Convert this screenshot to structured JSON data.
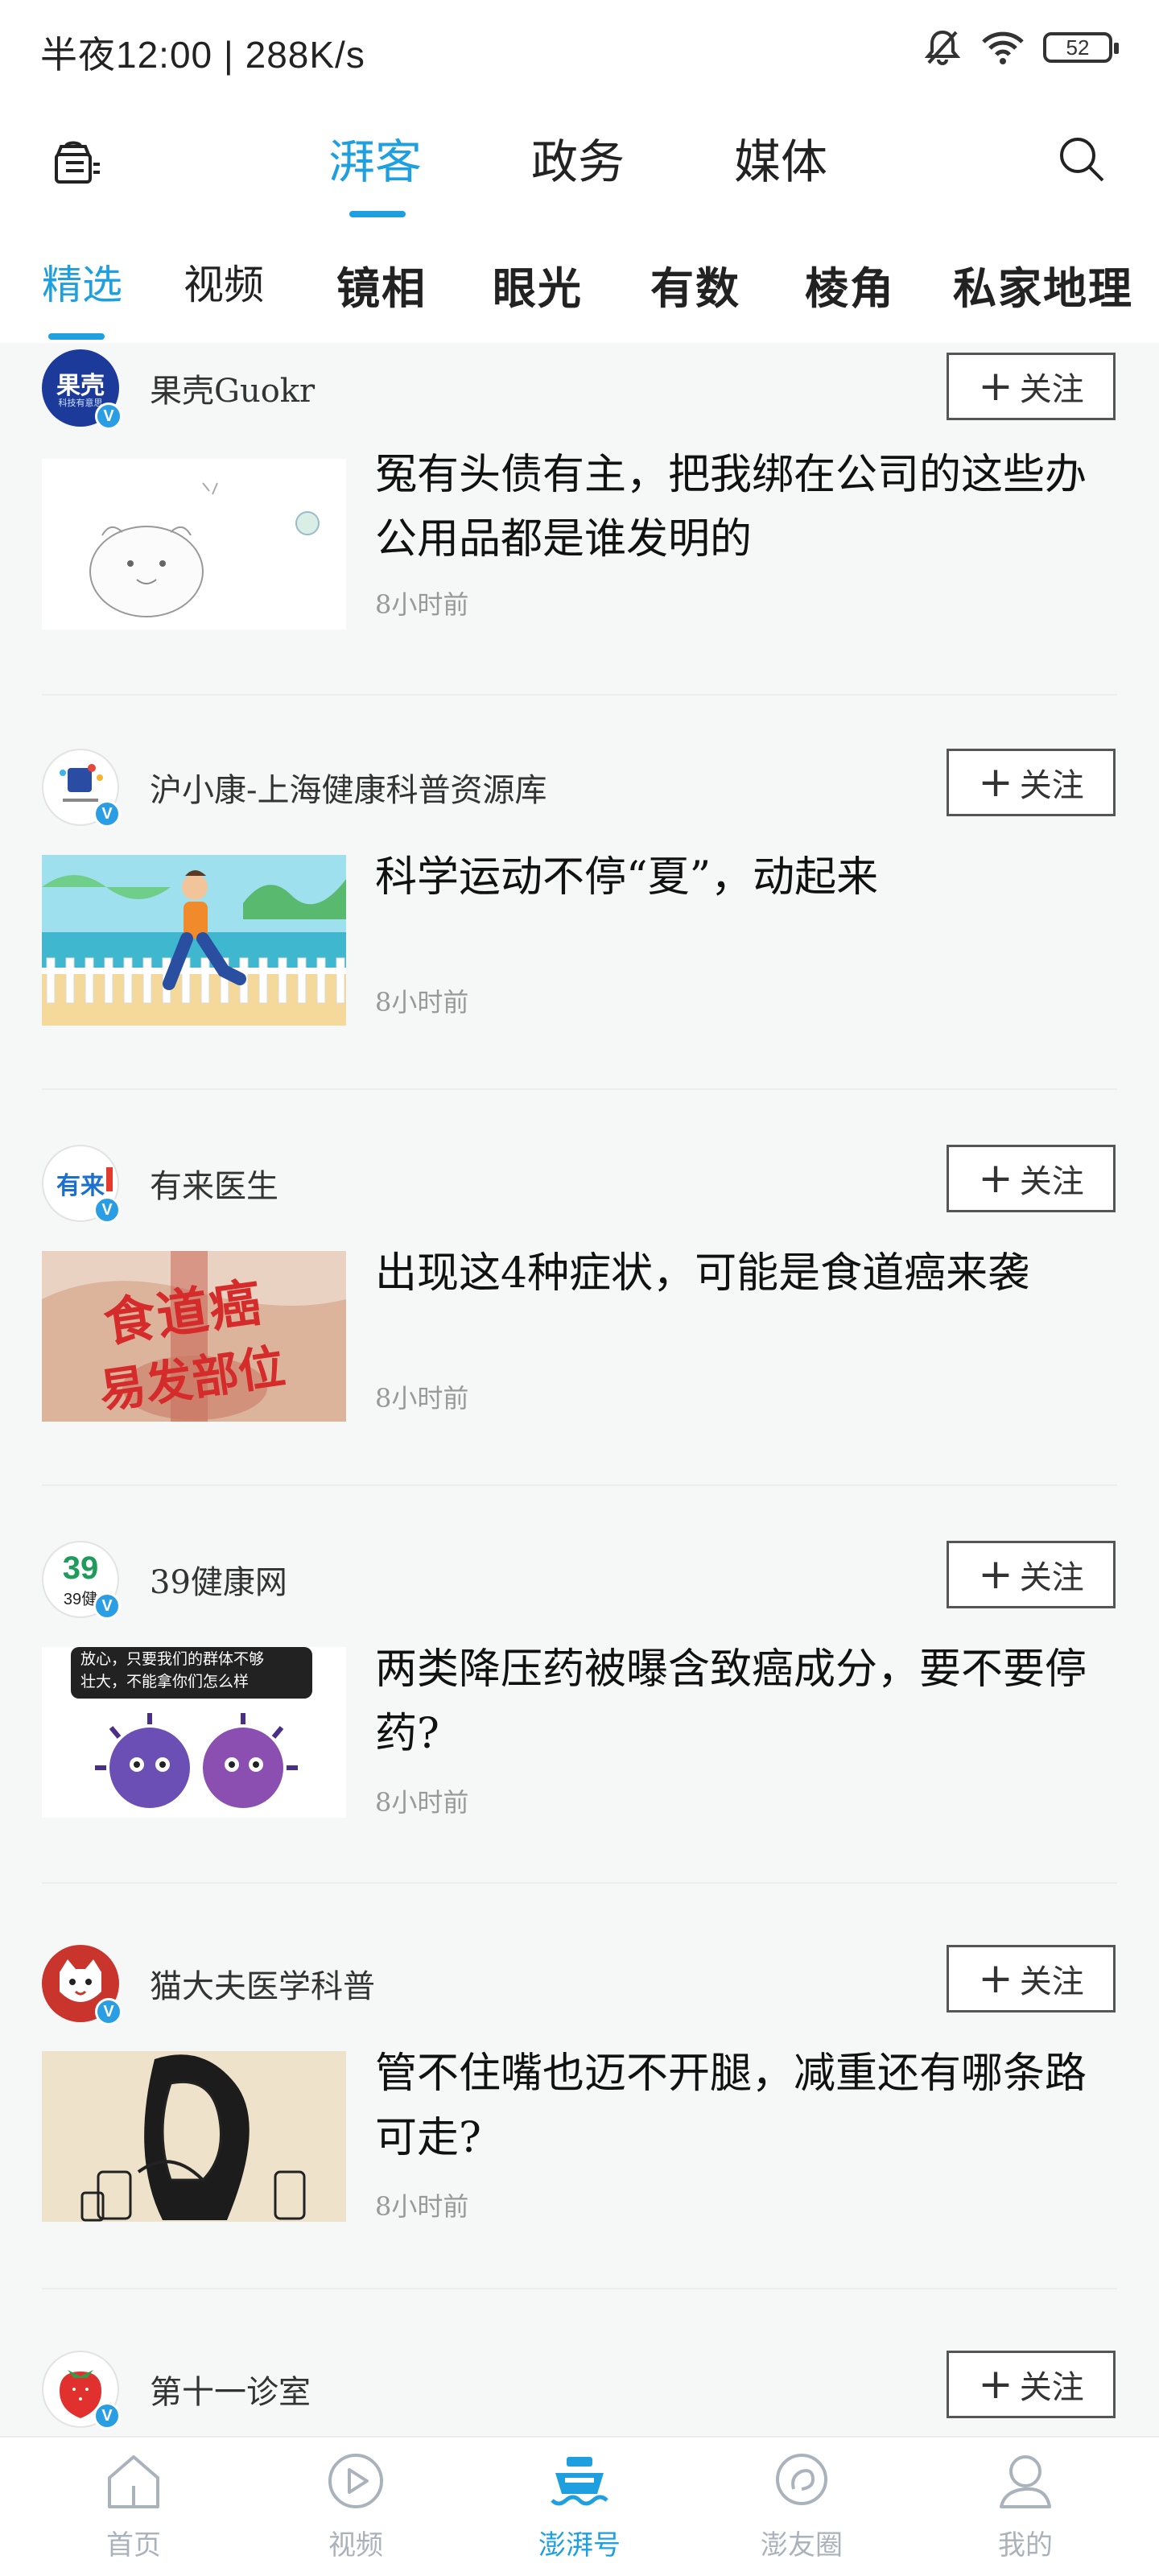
{
  "status_bar": {
    "time": "半夜12:00 | 288K/s",
    "battery": "52"
  },
  "header": {
    "tabs": [
      "湃客",
      "政务",
      "媒体"
    ],
    "active_tab": "湃客"
  },
  "subtabs": [
    "精选",
    "视频",
    "镜相",
    "眼光",
    "有数",
    "棱角",
    "私家地理"
  ],
  "follow_label": "关注",
  "feed": [
    {
      "author": "果壳Guokr",
      "title": "冤有头债有主，把我绑在公司的这些办公用品都是谁发明的",
      "time": "8小时前"
    },
    {
      "author": "沪小康-上海健康科普资源库",
      "title": "科学运动不停“夏”，动起来",
      "time": "8小时前"
    },
    {
      "author": "有来医生",
      "title": "出现这4种症状，可能是食道癌来袭",
      "time": "8小时前",
      "thumb_text": [
        "食道癌",
        "易发部位"
      ]
    },
    {
      "author": "39健康网",
      "title": "两类降压药被曝含致癌成分，要不要停药?",
      "time": "8小时前",
      "thumb_text": [
        "放心，只要我们的群体不够",
        "壮大，不能拿你们怎么样"
      ]
    },
    {
      "author": "猫大夫医学科普",
      "title": "管不住嘴也迈不开腿，减重还有哪条路可走?",
      "time": "8小时前"
    },
    {
      "author": "第十一诊室",
      "title": "",
      "time": ""
    }
  ],
  "avatars": {
    "guokr_text": "果壳",
    "guokr_sub": "科技有意思",
    "youlai_text": "有来",
    "39_text": "39",
    "39_sub": "39健"
  },
  "badge_label": "V",
  "bottom_nav": [
    "首页",
    "视频",
    "澎湃号",
    "澎友圈",
    "我的"
  ],
  "colors": {
    "accent": "#1ea0e0",
    "muted": "#aab2bb"
  }
}
